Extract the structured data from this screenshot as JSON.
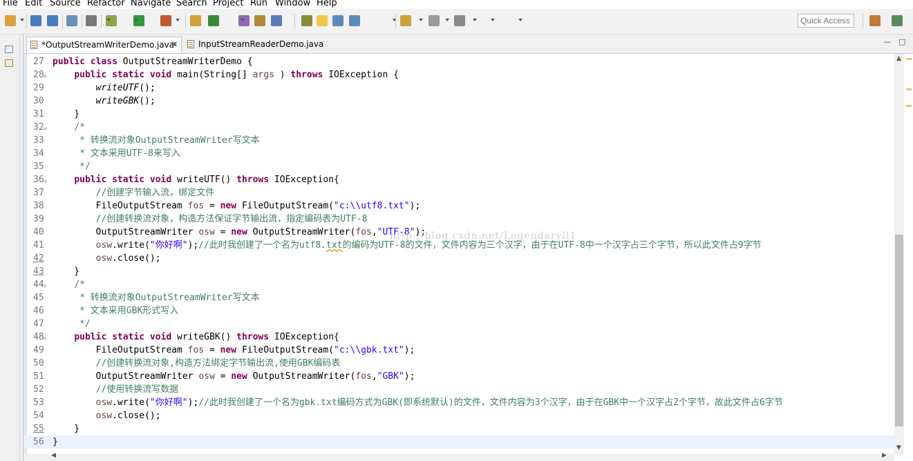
{
  "menu": [
    "File",
    "Edit",
    "Source",
    "Refactor",
    "Navigate",
    "Search",
    "Project",
    "Run",
    "Window",
    "Help"
  ],
  "toolbar": {
    "quick_access_placeholder": "Quick Access",
    "icons": [
      "new-icon",
      "save-icon",
      "save-all-icon",
      "print-icon",
      "skip-breakpoints-icon",
      "debug-icon",
      "run-icon",
      "external-tools-icon",
      "new-java-package-icon",
      "new-java-class-icon",
      "open-type-icon",
      "open-task-icon",
      "search-icon",
      "toggle-mark-occurrences-icon",
      "toggle-edit-mode-icon",
      "next-annotation-icon",
      "previous-annotation-icon",
      "back-icon",
      "forward-icon",
      "open-perspective-icon",
      "java-perspective-icon",
      "debug-perspective-icon"
    ]
  },
  "tabs": [
    {
      "label": "*OutputStreamWriterDemo.java",
      "active": true,
      "close": "✖"
    },
    {
      "label": "InputStreamReaderDemo.java",
      "active": false
    }
  ],
  "editor": {
    "window_buttons": {
      "minimize": "—",
      "maximize": "□"
    },
    "watermark": "http://blog.csdn.net/Legendaryll1",
    "lines": [
      {
        "num": "27",
        "fold": "",
        "segs": [
          [
            "kw",
            "public class "
          ],
          [
            "",
            "OutputStreamWriterDemo {"
          ]
        ]
      },
      {
        "num": "28",
        "fold": "⊖",
        "segs": [
          [
            "",
            "    "
          ],
          [
            "kw",
            "public static void "
          ],
          [
            "",
            "main(String[] "
          ],
          [
            "var",
            "args"
          ],
          [
            "",
            " ) "
          ],
          [
            "kw",
            "throws "
          ],
          [
            "",
            "IOException {"
          ]
        ]
      },
      {
        "num": "29",
        "fold": "",
        "segs": [
          [
            "",
            "        "
          ],
          [
            "it",
            "writeUTF"
          ],
          [
            "",
            "();"
          ]
        ]
      },
      {
        "num": "30",
        "fold": "",
        "segs": [
          [
            "",
            "        "
          ],
          [
            "it",
            "writeGBK"
          ],
          [
            "",
            "();"
          ]
        ]
      },
      {
        "num": "31",
        "fold": "",
        "segs": [
          [
            "",
            "    }"
          ]
        ]
      },
      {
        "num": "32",
        "fold": "⊖",
        "segs": [
          [
            "",
            "    "
          ],
          [
            "cm",
            "/*"
          ]
        ]
      },
      {
        "num": "33",
        "fold": "",
        "segs": [
          [
            "cm",
            "     * 转换流对象OutputStreamWriter写文本"
          ]
        ]
      },
      {
        "num": "34",
        "fold": "",
        "segs": [
          [
            "cm",
            "     * 文本采用UTF-8来写入"
          ]
        ]
      },
      {
        "num": "35",
        "fold": "",
        "segs": [
          [
            "cm",
            "     */"
          ]
        ]
      },
      {
        "num": "36",
        "fold": "⊖",
        "segs": [
          [
            "",
            "    "
          ],
          [
            "kw",
            "public static void "
          ],
          [
            "",
            "writeUTF() "
          ],
          [
            "kw",
            "throws "
          ],
          [
            "",
            "IOException{"
          ]
        ]
      },
      {
        "num": "37",
        "fold": "",
        "segs": [
          [
            "",
            "        "
          ],
          [
            "cm",
            "//创建字节输入流，绑定文件"
          ]
        ]
      },
      {
        "num": "38",
        "fold": "",
        "segs": [
          [
            "",
            "        FileOutputStream "
          ],
          [
            "var",
            "fos"
          ],
          [
            "",
            " = "
          ],
          [
            "kw",
            "new "
          ],
          [
            "",
            "FileOutputStream("
          ],
          [
            "str",
            "\"c:\\\\utf8.txt\""
          ],
          [
            "",
            ");"
          ]
        ]
      },
      {
        "num": "39",
        "fold": "",
        "segs": [
          [
            "",
            "        "
          ],
          [
            "cm",
            "//创建转换流对象，构造方法保证字节输出流，指定编码表为UTF-8"
          ]
        ]
      },
      {
        "num": "40",
        "fold": "",
        "segs": [
          [
            "",
            "        OutputStreamWriter "
          ],
          [
            "var",
            "osw"
          ],
          [
            "",
            " = "
          ],
          [
            "kw",
            "new "
          ],
          [
            "",
            "OutputStreamWriter("
          ],
          [
            "var",
            "fos"
          ],
          [
            "",
            ","
          ],
          [
            "str",
            "\"UTF-8\""
          ],
          [
            "",
            ");"
          ]
        ]
      },
      {
        "num": "41",
        "fold": "",
        "segs": [
          [
            "",
            "        "
          ],
          [
            "var",
            "osw"
          ],
          [
            "",
            ".write("
          ],
          [
            "str",
            "\"你好啊\""
          ],
          [
            "",
            ");"
          ],
          [
            "cm",
            "//此时我创建了一个名为utf8."
          ],
          [
            "cm squig",
            "txt"
          ],
          [
            "cm",
            "的编码为UTF-8的文件，文件内容为三个汉字，由于在UTF-8中一个汉字占三个字节，所以此文件占9字节"
          ]
        ]
      },
      {
        "num": "42",
        "fold": "",
        "segs": [
          [
            "",
            "        "
          ],
          [
            "var",
            "osw"
          ],
          [
            "",
            ".close();"
          ]
        ]
      },
      {
        "num": "43",
        "fold": "",
        "segs": [
          [
            "",
            "    }"
          ]
        ]
      },
      {
        "num": "44",
        "fold": "⊖",
        "segs": [
          [
            "",
            "    "
          ],
          [
            "cm",
            "/*"
          ]
        ]
      },
      {
        "num": "45",
        "fold": "",
        "segs": [
          [
            "cm",
            "     * 转换流对象OutputStreamWriter写文本"
          ]
        ]
      },
      {
        "num": "46",
        "fold": "",
        "segs": [
          [
            "cm",
            "     * 文本采用GBK形式写入"
          ]
        ]
      },
      {
        "num": "47",
        "fold": "",
        "segs": [
          [
            "cm",
            "     */"
          ]
        ]
      },
      {
        "num": "48",
        "fold": "⊖",
        "segs": [
          [
            "",
            "    "
          ],
          [
            "kw",
            "public static void "
          ],
          [
            "",
            "writeGBK() "
          ],
          [
            "kw",
            "throws "
          ],
          [
            "",
            "IOException{"
          ]
        ]
      },
      {
        "num": "49",
        "fold": "",
        "segs": [
          [
            "",
            "        FileOutputStream "
          ],
          [
            "var",
            "fos"
          ],
          [
            "",
            " = "
          ],
          [
            "kw",
            "new "
          ],
          [
            "",
            "FileOutputStream("
          ],
          [
            "str",
            "\"c:\\\\gbk.txt\""
          ],
          [
            "",
            ");"
          ]
        ]
      },
      {
        "num": "50",
        "fold": "",
        "segs": [
          [
            "",
            "        "
          ],
          [
            "cm",
            "//创建转换流对象,构造方法绑定字节输出流,使用GBK编码表"
          ]
        ]
      },
      {
        "num": "51",
        "fold": "",
        "segs": [
          [
            "",
            "        OutputStreamWriter "
          ],
          [
            "var",
            "osw"
          ],
          [
            "",
            " = "
          ],
          [
            "kw",
            "new "
          ],
          [
            "",
            "OutputStreamWriter("
          ],
          [
            "var",
            "fos"
          ],
          [
            "",
            ","
          ],
          [
            "str",
            "\"GBK\""
          ],
          [
            "",
            ");"
          ]
        ]
      },
      {
        "num": "52",
        "fold": "",
        "segs": [
          [
            "",
            "        "
          ],
          [
            "cm",
            "//使用转换流写数据"
          ]
        ]
      },
      {
        "num": "53",
        "fold": "",
        "segs": [
          [
            "",
            "        "
          ],
          [
            "var",
            "osw"
          ],
          [
            "",
            ".write("
          ],
          [
            "str",
            "\"你好啊\""
          ],
          [
            "",
            ");"
          ],
          [
            "cm",
            "//此时我创建了一个名为gbk.txt编码方式为GBK(即系统默认)的文件，文件内容为3个汉字，由于在GBK中一个汉字占2个字节，故此文件占6字节"
          ]
        ]
      },
      {
        "num": "54",
        "fold": "",
        "segs": [
          [
            "",
            "        "
          ],
          [
            "var",
            "osw"
          ],
          [
            "",
            ".close();"
          ]
        ]
      },
      {
        "num": "55",
        "fold": "",
        "segs": [
          [
            "",
            "    }"
          ]
        ]
      },
      {
        "num": "56",
        "fold": "",
        "segs": [
          [
            "",
            "}"
          ]
        ]
      }
    ],
    "current_line": "56",
    "underlined_lines": [
      "42",
      "43",
      "55"
    ]
  },
  "colors": {
    "keyword": "#7f0055",
    "comment": "#3f7f5f",
    "string": "#2a00ff",
    "variable": "#6a3e3e",
    "current_line": "#e8f2fe"
  }
}
